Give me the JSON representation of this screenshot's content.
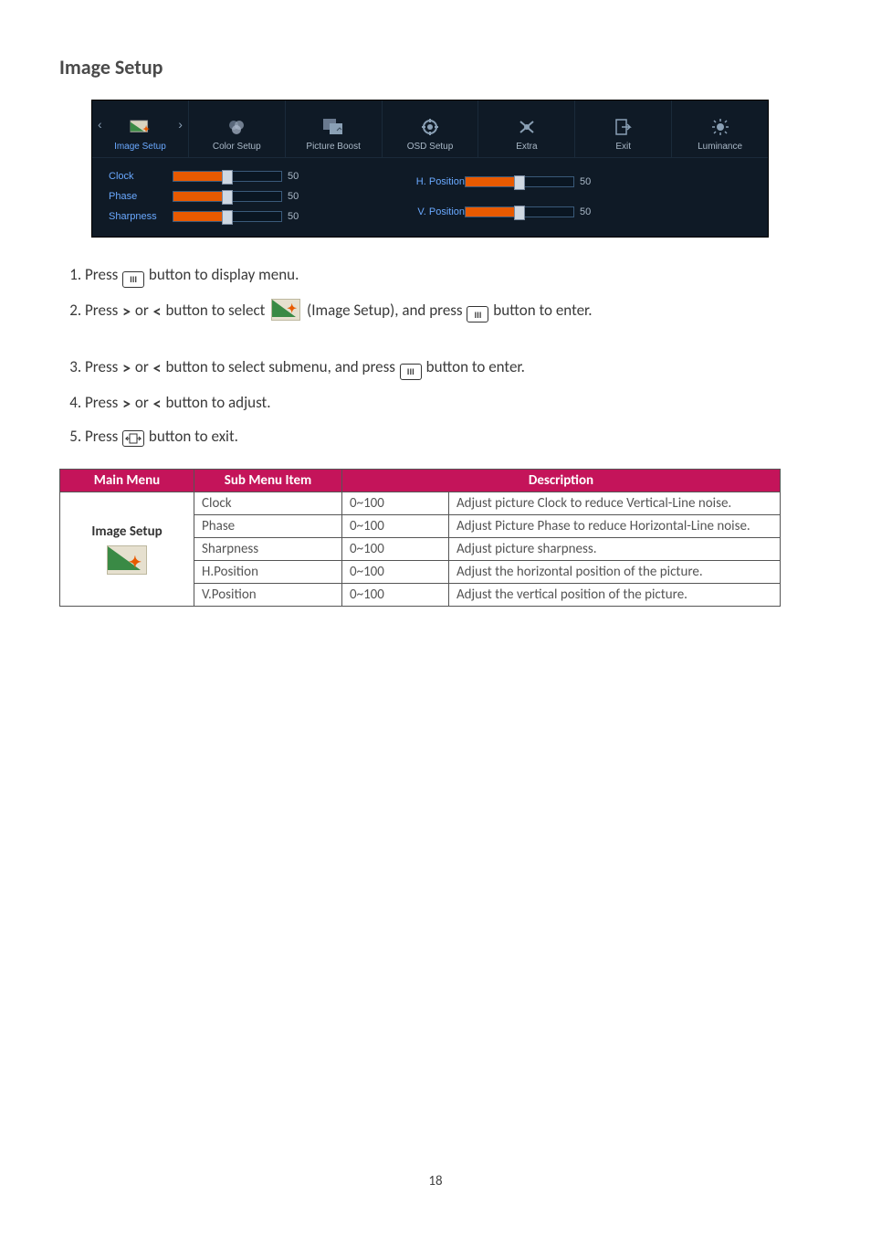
{
  "section_title": "Image Setup",
  "osd": {
    "tabs": [
      {
        "id": "image-setup",
        "label": "Image Setup",
        "active": true
      },
      {
        "id": "color-setup",
        "label": "Color Setup",
        "active": false
      },
      {
        "id": "picture-boost",
        "label": "Picture Boost",
        "active": false
      },
      {
        "id": "osd-setup",
        "label": "OSD Setup",
        "active": false
      },
      {
        "id": "extra",
        "label": "Extra",
        "active": false
      },
      {
        "id": "exit",
        "label": "Exit",
        "active": false
      },
      {
        "id": "luminance",
        "label": "Luminance",
        "active": false
      }
    ],
    "left_items": [
      {
        "label": "Clock",
        "value": 50
      },
      {
        "label": "Phase",
        "value": 50
      },
      {
        "label": "Sharpness",
        "value": 50
      }
    ],
    "right_items": [
      {
        "label": "H. Position",
        "value": 50
      },
      {
        "label": "V. Position",
        "value": 50
      }
    ]
  },
  "steps": {
    "s1_a": "Press ",
    "s1_b": " button to display menu.",
    "s2_a": "Press ",
    "s2_b": " or ",
    "s2_c": " button to select ",
    "s2_d": " (Image Setup), and press ",
    "s2_e": " button to enter.",
    "s3_a": "Press ",
    "s3_b": " or ",
    "s3_c": " button to select submenu, and press ",
    "s3_d": " button to enter.",
    "s4_a": "Press ",
    "s4_b": " or ",
    "s4_c": " button to adjust.",
    "s5_a": "Press ",
    "s5_b": " button to exit."
  },
  "table": {
    "headers": [
      "Main Menu",
      "Sub Menu Item",
      "Description"
    ],
    "main_menu_label": "Image Setup",
    "rows": [
      {
        "sub": "Clock",
        "range": "0~100",
        "desc": "Adjust picture Clock to reduce Vertical-Line noise."
      },
      {
        "sub": "Phase",
        "range": "0~100",
        "desc": "Adjust Picture Phase to reduce Horizontal-Line noise."
      },
      {
        "sub": "Sharpness",
        "range": "0~100",
        "desc": "Adjust picture sharpness."
      },
      {
        "sub": "H.Position",
        "range": "0~100",
        "desc": "Adjust the horizontal position of the picture."
      },
      {
        "sub": "V.Position",
        "range": "0~100",
        "desc": "Adjust the vertical position of the picture."
      }
    ]
  },
  "page_number": "18"
}
